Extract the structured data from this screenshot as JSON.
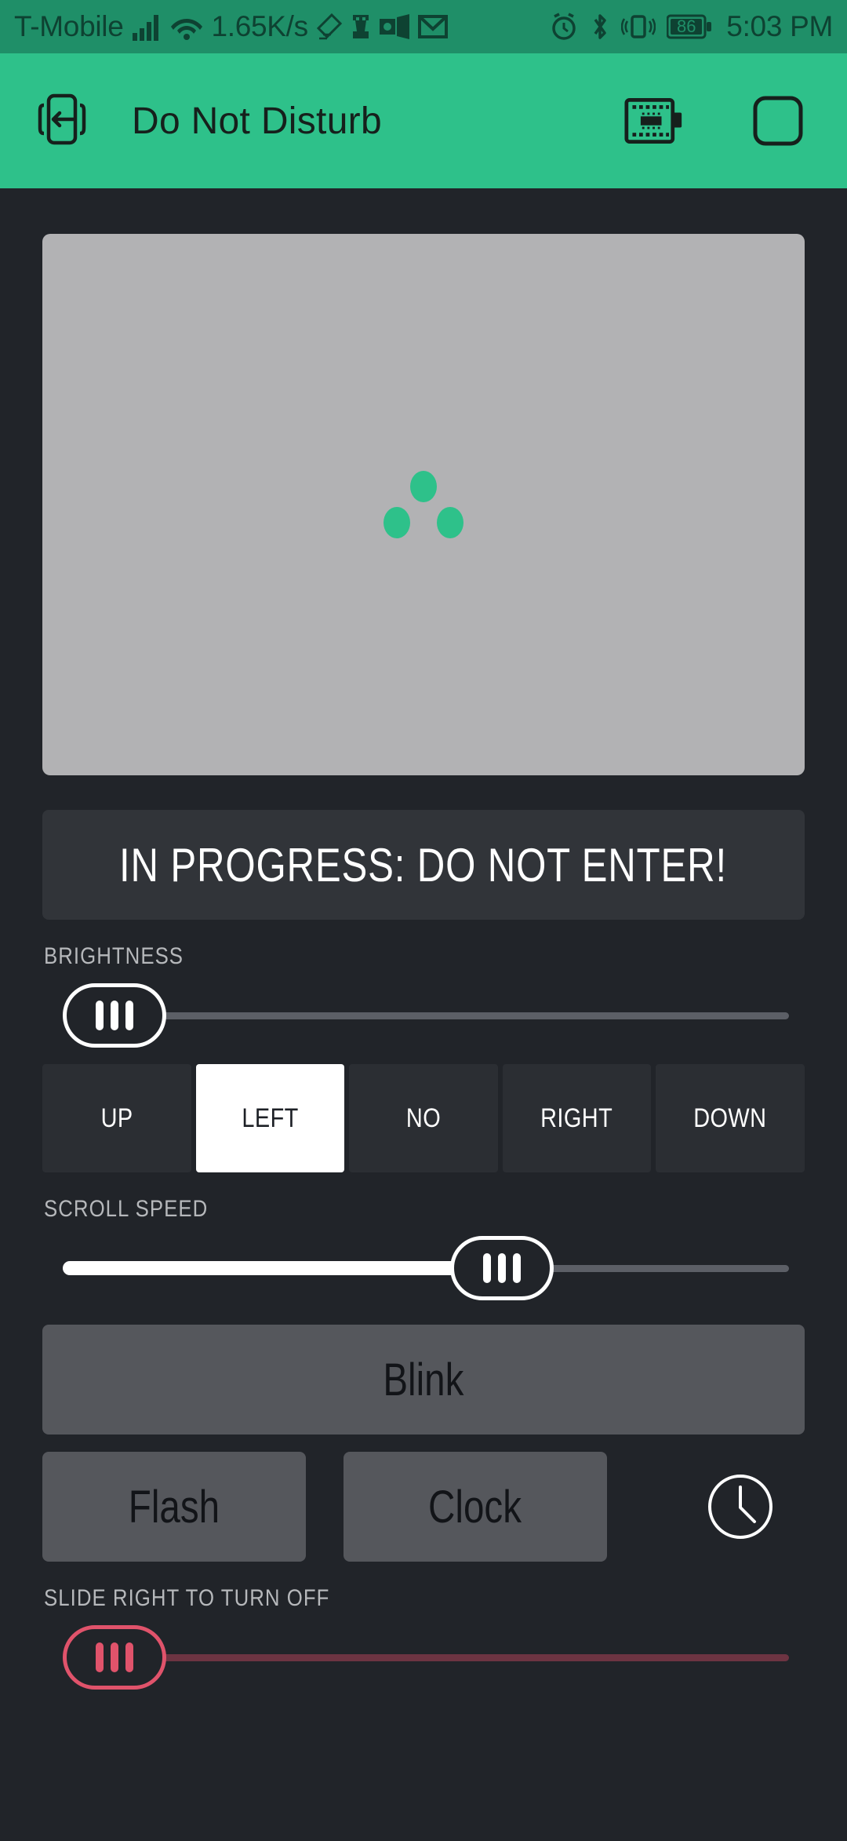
{
  "status_bar": {
    "carrier": "T-Mobile",
    "network_speed": "1.65K/s",
    "battery_level": "86",
    "time": "5:03 PM",
    "icons": [
      "signal-bars-icon",
      "wifi-icon",
      "eraser-icon",
      "chess-rook-icon",
      "outlook-icon",
      "gmail-icon",
      "alarm-icon",
      "bluetooth-icon",
      "vibrate-icon",
      "battery-icon"
    ],
    "background_color": "#1f8f68"
  },
  "app_bar": {
    "title": "Do Not Disturb",
    "back_icon": "phone-exit-icon",
    "action_icons": [
      "circuit-board-icon",
      "rounded-square-icon"
    ],
    "background_color": "#2ec18a"
  },
  "preview": {
    "loading_indicator": "three-dots-loading",
    "background_color": "#b2b2b4",
    "dot_color": "#2ec18a"
  },
  "banner": {
    "message": "IN PROGRESS: DO NOT ENTER!",
    "background_color": "#313439",
    "text_color": "#ffffff"
  },
  "brightness": {
    "label": "BRIGHTNESS",
    "value_percent": 0,
    "thumb_icon": "grip-handle-icon"
  },
  "direction": {
    "options": [
      {
        "label": "UP",
        "selected": false
      },
      {
        "label": "LEFT",
        "selected": true
      },
      {
        "label": "NO",
        "selected": false
      },
      {
        "label": "RIGHT",
        "selected": false
      },
      {
        "label": "DOWN",
        "selected": false
      }
    ],
    "selected": "LEFT"
  },
  "scroll_speed": {
    "label": "SCROLL SPEED",
    "value_percent": 62,
    "thumb_icon": "grip-handle-icon"
  },
  "actions": {
    "blink_label": "Blink",
    "flash_label": "Flash",
    "clock_label": "Clock",
    "clock_icon": "clock-icon"
  },
  "turn_off": {
    "label": "SLIDE RIGHT TO TURN OFF",
    "value_percent": 0,
    "accent_color": "#e0536b",
    "thumb_icon": "grip-handle-icon"
  }
}
